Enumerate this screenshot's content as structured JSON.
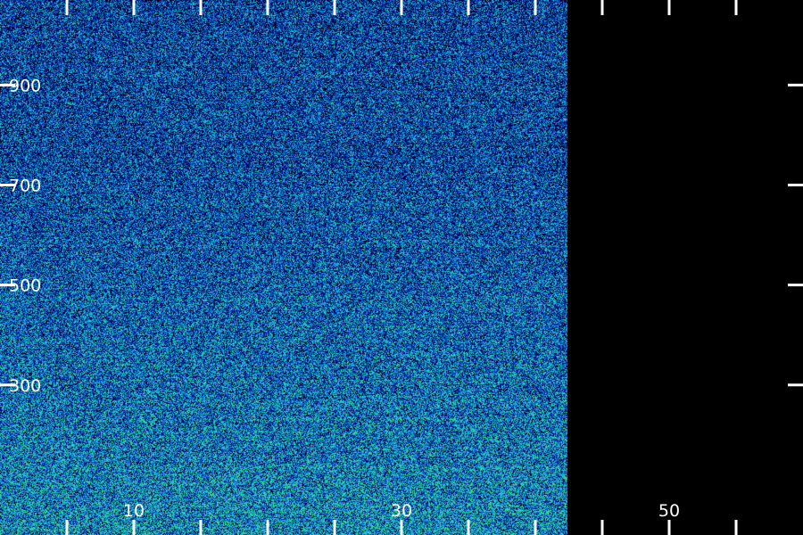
{
  "chart_data": {
    "type": "heatmap",
    "title": "",
    "xlabel": "",
    "ylabel": "",
    "xlim": [
      0,
      60
    ],
    "ylim": [
      0,
      1070
    ],
    "data_extent": {
      "x": [
        0,
        42.4
      ],
      "y": [
        0,
        1070
      ]
    },
    "grid": false,
    "legend": "none",
    "x_ticks": {
      "major": [
        10,
        30,
        50
      ],
      "minor": [
        5,
        15,
        20,
        25,
        35,
        40,
        45,
        55
      ],
      "labels": [
        "10",
        "30",
        "50"
      ]
    },
    "y_ticks": {
      "major": [
        300,
        500,
        700,
        900
      ],
      "labels": [
        "300",
        "500",
        "700",
        "900"
      ]
    },
    "colormap": {
      "low": "#00004a",
      "mid_low": "#0033b8",
      "mid": "#1a8fd6",
      "mid_high": "#2fd0c0",
      "high": "#39e86a",
      "zero": "#000000"
    },
    "background": "#000000",
    "tick_color": "#ffffff",
    "label_color": "#ffffff"
  }
}
